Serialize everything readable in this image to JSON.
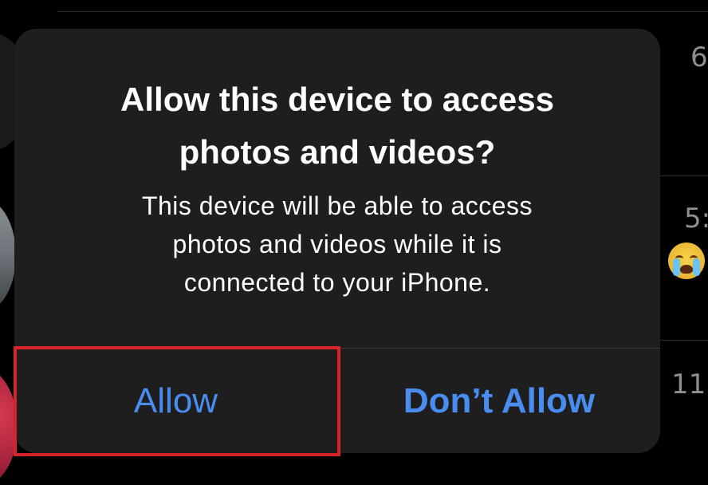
{
  "background": {
    "times": [
      "6",
      "5:",
      "11:"
    ]
  },
  "dialog": {
    "title_line1": "Allow this device to access",
    "title_line2": "photos and videos?",
    "message_line1": "This device will be able to access",
    "message_line2": "photos and videos while it is",
    "message_line3": "connected to your iPhone.",
    "buttons": {
      "allow": "Allow",
      "dont_allow": "Don’t Allow"
    }
  },
  "colors": {
    "background": "#000000",
    "dialog_bg": "#1e1e1e",
    "accent_blue": "#4a8df0",
    "highlight_red": "#d9232b",
    "secondary_text": "#8e8e93"
  }
}
